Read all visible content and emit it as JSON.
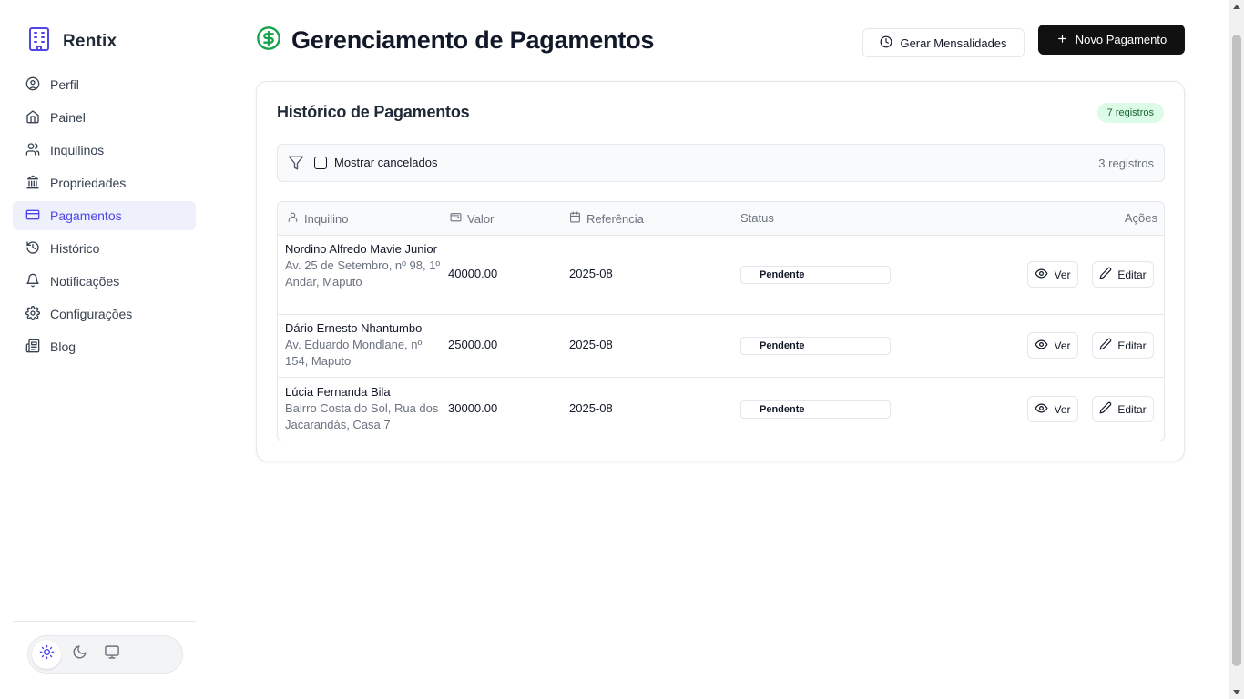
{
  "app": {
    "name": "Rentix"
  },
  "sidebar": {
    "items": [
      {
        "label": "Perfil",
        "icon": "user-circle-icon"
      },
      {
        "label": "Painel",
        "icon": "home-icon"
      },
      {
        "label": "Inquilinos",
        "icon": "users-icon"
      },
      {
        "label": "Propriedades",
        "icon": "bank-icon"
      },
      {
        "label": "Pagamentos",
        "icon": "credit-card-icon",
        "active": true
      },
      {
        "label": "Histórico",
        "icon": "history-icon"
      },
      {
        "label": "Notificações",
        "icon": "bell-icon"
      },
      {
        "label": "Configurações",
        "icon": "gear-icon"
      },
      {
        "label": "Blog",
        "icon": "newspaper-icon"
      }
    ],
    "theme_options": [
      "light",
      "dark",
      "system"
    ],
    "theme_selected": "light"
  },
  "header": {
    "title": "Gerenciamento de Pagamentos",
    "generate_label": "Gerar Mensalidades",
    "new_label": "Novo Pagamento"
  },
  "card": {
    "title": "Histórico de Pagamentos",
    "badge": "7 registros",
    "filter": {
      "checkbox_label": "Mostrar cancelados",
      "checked": false,
      "count": "3 registros"
    },
    "columns": {
      "tenant": "Inquilino",
      "value": "Valor",
      "reference": "Referência",
      "status": "Status",
      "actions": "Ações"
    },
    "rows": [
      {
        "name": "Nordino Alfredo Mavie Junior",
        "address": "Av. 25 de Setembro, nº 98, 1º Andar, Maputo",
        "value": "40000.00",
        "reference": "2025-08",
        "status": "Pendente",
        "view_label": "Ver",
        "edit_label": "Editar"
      },
      {
        "name": "Dário Ernesto Nhantumbo",
        "address": "Av. Eduardo Mondlane, nº 154, Maputo",
        "value": "25000.00",
        "reference": "2025-08",
        "status": "Pendente",
        "view_label": "Ver",
        "edit_label": "Editar"
      },
      {
        "name": "Lúcia Fernanda Bila",
        "address": "Bairro Costa do Sol, Rua dos Jacarandás, Casa 7",
        "value": "30000.00",
        "reference": "2025-08",
        "status": "Pendente",
        "view_label": "Ver",
        "edit_label": "Editar"
      }
    ]
  },
  "colors": {
    "accent": "#4f46e5",
    "active_bg": "#eef0fb",
    "title_icon": "#16a34a",
    "badge_bg": "#dcfce7",
    "badge_text": "#166534",
    "primary_button": "#111111"
  }
}
